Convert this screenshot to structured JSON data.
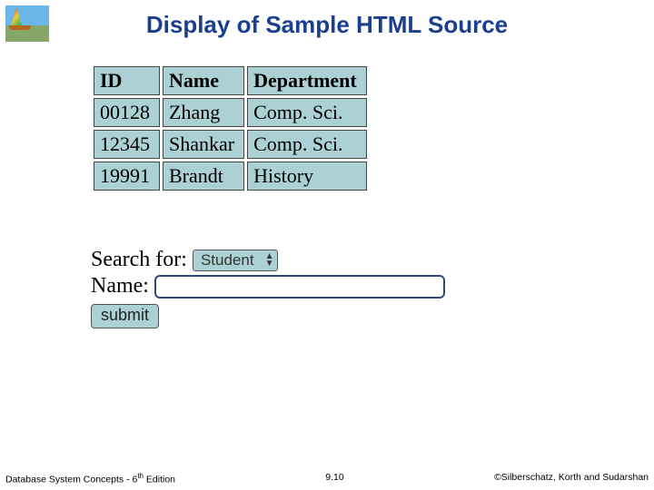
{
  "title": "Display of Sample HTML Source",
  "table": {
    "headers": {
      "c0": "ID",
      "c1": "Name",
      "c2": "Department"
    },
    "rows": [
      {
        "c0": "00128",
        "c1": "Zhang",
        "c2": "Comp. Sci."
      },
      {
        "c0": "12345",
        "c1": "Shankar",
        "c2": "Comp. Sci."
      },
      {
        "c0": "19991",
        "c1": "Brandt",
        "c2": "History"
      }
    ]
  },
  "form": {
    "search_label": "Search for:",
    "search_selected": "Student",
    "name_label": "Name:",
    "name_value": "",
    "submit_label": "submit"
  },
  "footer": {
    "left_prefix": "Database System Concepts - 6",
    "left_ord": "th",
    "left_suffix": " Edition",
    "center": "9.10",
    "right": "©Silberschatz, Korth and Sudarshan"
  }
}
